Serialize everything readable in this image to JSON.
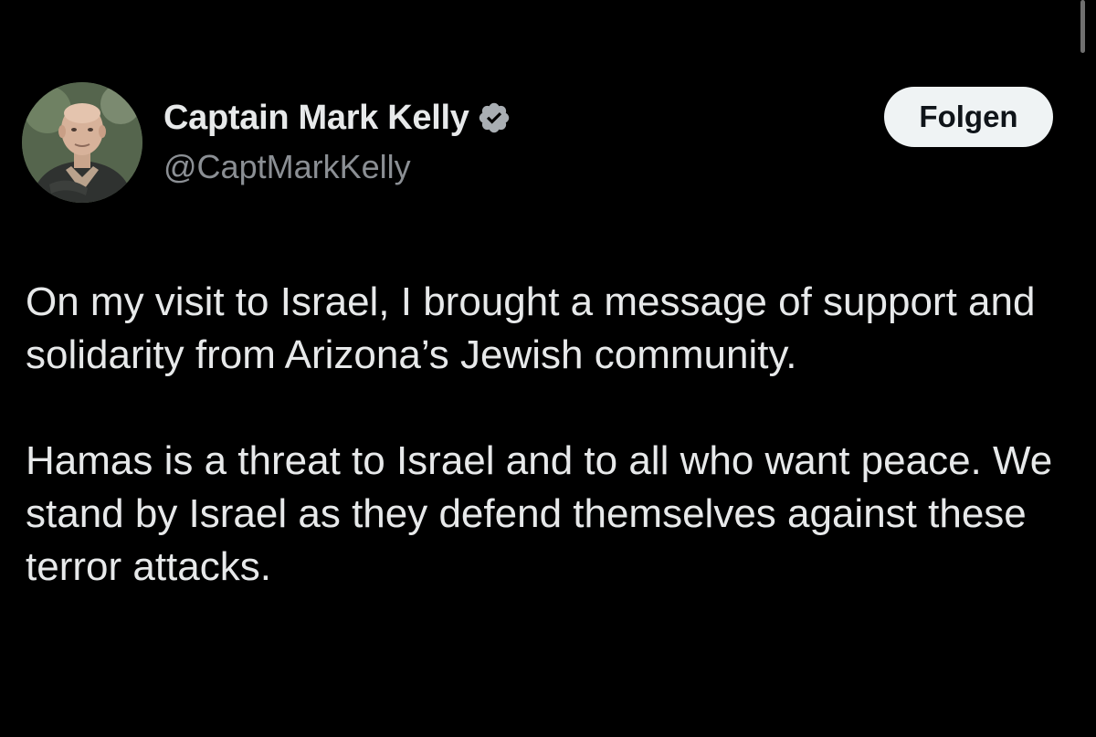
{
  "author": {
    "display_name": "Captain Mark Kelly",
    "handle": "@CaptMarkKelly",
    "verified": true,
    "avatar_icon": "profile-photo-man",
    "verified_icon": "verified-badge-icon"
  },
  "actions": {
    "follow_label": "Folgen"
  },
  "tweet": {
    "paragraphs": [
      "On my visit to Israel, I brought a message of support and solidarity from Arizona’s Jewish community.",
      "Hamas is a threat to Israel and to all who want peace. We stand by Israel as they defend themselves against these terror attacks."
    ]
  },
  "colors": {
    "background": "#000000",
    "text_primary": "#e7e9ea",
    "text_secondary": "#8b8f94",
    "follow_button_bg": "#eff3f4",
    "follow_button_text": "#0f1419",
    "verified_badge": "#a9aeb3"
  }
}
